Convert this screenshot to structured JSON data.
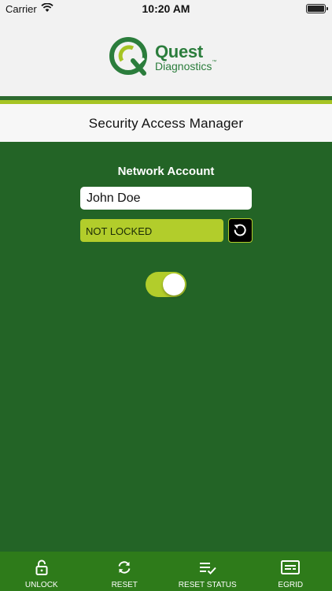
{
  "status_bar": {
    "carrier": "Carrier",
    "time": "10:20 AM"
  },
  "brand": {
    "name_line1": "Quest",
    "name_line2": "Diagnostics",
    "trademark": "™",
    "color": "#2b7d3c"
  },
  "title": "Security Access Manager",
  "form": {
    "network_label": "Network Account",
    "account_value": "John Doe",
    "lock_status": "NOT LOCKED",
    "toggle_on": true
  },
  "colors": {
    "primary_green": "#236426",
    "accent_lime": "#b2cd2b",
    "tab_bar": "#2e7b1a"
  },
  "tabs": [
    {
      "label": "UNLOCK",
      "icon": "lock-icon"
    },
    {
      "label": "RESET",
      "icon": "sync-icon"
    },
    {
      "label": "RESET STATUS",
      "icon": "list-check-icon"
    },
    {
      "label": "EGRID",
      "icon": "card-icon"
    }
  ]
}
